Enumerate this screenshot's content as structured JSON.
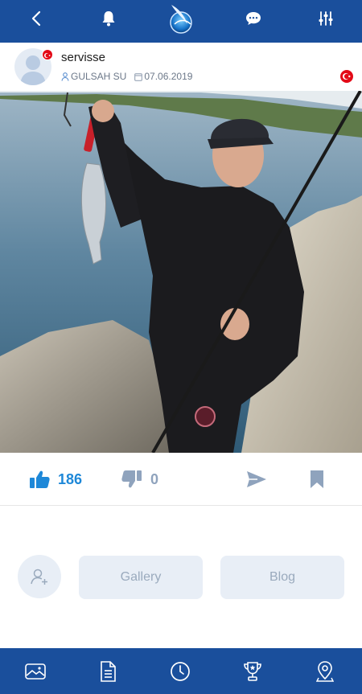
{
  "topbar": {
    "icons": [
      "back-icon",
      "bell-icon",
      "app-logo",
      "chat-bubble-icon",
      "sliders-icon"
    ],
    "color": "#1a4f9c"
  },
  "post": {
    "username": "servisse",
    "author": "GULSAH SU",
    "date": "07.06.2019",
    "country_flag_color": "#e30a17"
  },
  "actions": {
    "like_count": "186",
    "dislike_count": "0",
    "like_color": "#1e88d8",
    "muted_color": "#8fa3bd"
  },
  "profile_actions": {
    "gallery_label": "Gallery",
    "blog_label": "Blog"
  },
  "bottomnav": {
    "icons": [
      "image-card-icon",
      "document-icon",
      "clock-icon",
      "trophy-icon",
      "map-pin-icon"
    ]
  }
}
